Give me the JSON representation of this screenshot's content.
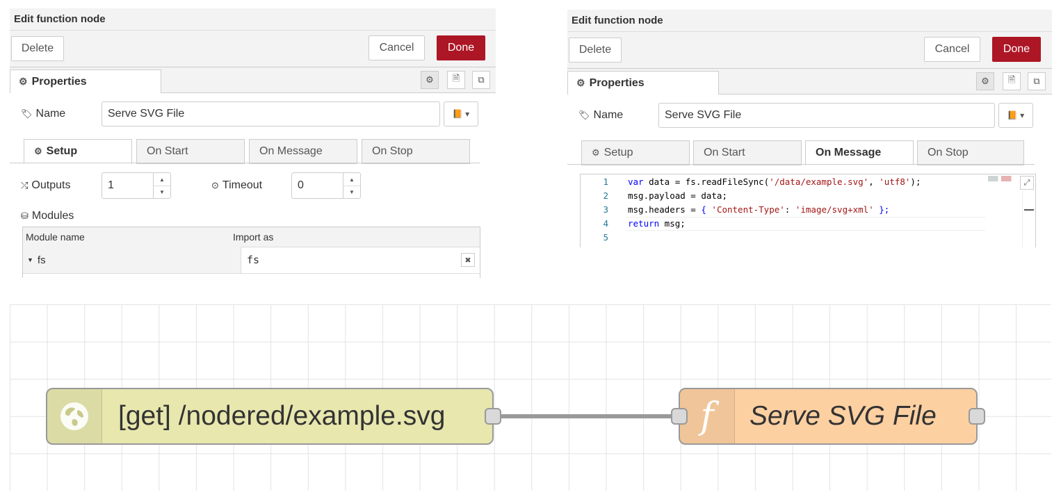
{
  "left_panel": {
    "title": "Edit function node",
    "delete_label": "Delete",
    "cancel_label": "Cancel",
    "done_label": "Done",
    "properties_tab": "Properties",
    "name_label": "Name",
    "name_value": "Serve SVG File",
    "subtabs": [
      "Setup",
      "On Start",
      "On Message",
      "On Stop"
    ],
    "active_subtab": "Setup",
    "outputs_label": "Outputs",
    "outputs_value": "1",
    "timeout_label": "Timeout",
    "timeout_value": "0",
    "modules_label": "Modules",
    "modules_header": {
      "name": "Module name",
      "import": "Import as"
    },
    "modules_rows": [
      {
        "name": "fs",
        "import": "fs"
      }
    ]
  },
  "right_panel": {
    "title": "Edit function node",
    "delete_label": "Delete",
    "cancel_label": "Cancel",
    "done_label": "Done",
    "properties_tab": "Properties",
    "name_label": "Name",
    "name_value": "Serve SVG File",
    "subtabs": [
      "Setup",
      "On Start",
      "On Message",
      "On Stop"
    ],
    "active_subtab": "On Message",
    "code_line_numbers": [
      "1",
      "2",
      "3",
      "4",
      "5"
    ],
    "code": {
      "l1": {
        "kw": "var",
        "a": " data = fs.readFileSync(",
        "s1": "'/data/example.svg'",
        "b": ", ",
        "s2": "'utf8'",
        "c": ");"
      },
      "l2": "msg.payload = data;",
      "l3": {
        "a": "msg.headers = ",
        "b": "{ ",
        "s1": "'Content-Type'",
        "c": ": ",
        "s2": "'image/svg+xml'",
        "d": " };"
      },
      "l4": {
        "kw": "return",
        "a": " msg;"
      },
      "l5": ""
    }
  },
  "flow": {
    "http_node_label": "[get] /nodered/example.svg",
    "function_node_label": "Serve SVG File",
    "function_icon": "f"
  },
  "colors": {
    "done_button": "#ad1625",
    "http_node": "#e7e7ae",
    "function_node": "#fdd0a2",
    "wire": "#999999"
  },
  "icons": [
    "gear-icon",
    "tag-icon",
    "book-icon",
    "shuffle-icon",
    "clock-icon",
    "cubes-icon",
    "globe-icon",
    "function-icon",
    "expand-icon"
  ]
}
